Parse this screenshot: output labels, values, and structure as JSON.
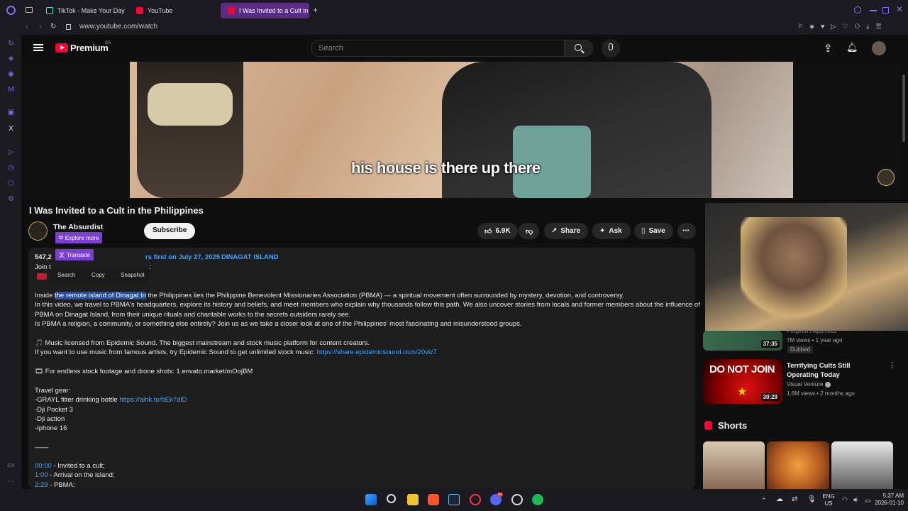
{
  "browser": {
    "tabs": [
      {
        "label": "TikTok - Make Your Day"
      },
      {
        "label": "YouTube"
      },
      {
        "label": "I Was Invited to a Cult in the Philippines"
      }
    ],
    "url": "www.youtube.com/watch"
  },
  "youtube": {
    "logo": "Premium",
    "region": "CA",
    "search_placeholder": "Search"
  },
  "video": {
    "caption": "his house is there up there",
    "title": "I Was Invited to a Cult in the Philippines",
    "channel": "The Absurdist",
    "subscribe_label": "Subscribe",
    "likes": "6.9K",
    "share_label": "Share",
    "ask_label": "Ask",
    "save_label": "Save"
  },
  "popup": {
    "explore": "Explore more",
    "translate": "Translate",
    "search": "Search",
    "copy": "Copy",
    "snapshot": "Snapshot"
  },
  "description": {
    "views_prefix": "547,2",
    "premiere_suffix": "rs first on July 27, 2025",
    "tag": "DINAGAT ISLAND",
    "join_prefix": "Join t",
    "join_suffix": ":",
    "p1_a": "Inside ",
    "p1_sel": "the remote island of Dinagat in",
    "p1_b": " the Philippines lies the Philippine Benevolent Missionaries Association (PBMA) — a spiritual movement often surrounded by mystery, devotion, and controversy.",
    "p2": "In this video, we travel to PBMA's headquarters, explore its history and beliefs, and meet members who explain why thousands follow this path. We also uncover stories from locals and former members about the influence of",
    "p3": "PBMA on Dinagat Island, from their unique rituals and charitable works to the secrets outsiders rarely see.",
    "p4": "Is PBMA a religion, a community, or something else entirely? Join us as we take a closer look at one of the Philippines' most fascinating and misunderstood groups.",
    "music1": "🎵 Music licensed from Epidemic Sound. The biggest mainstream and stock music platform for content creators.",
    "music2": "If you want to use music from famous artists, try Epidemic Sound to get unlimited stock music: ",
    "music_link": "https://share.epidemicsound.com/20vlz7",
    "stock": "🎞 For endless stock footage and drone shots: 1.envato.market/mOojBM",
    "gear_title": "Travel gear:",
    "gear1": "-GRAYL filter drinking bottle ",
    "gear1_link": "https://alnk.to/bEk7dlD",
    "gear2": "-Dji Pocket 3",
    "gear3": "-Dji action",
    "gear4": "-Iphone 16",
    "divider": "——",
    "chapters": [
      {
        "time": "00:00",
        "label": " - Invited to a cult;"
      },
      {
        "time": "1:00",
        "label": " - Arrival on the island;"
      },
      {
        "time": "2:29",
        "label": " - PBMA;"
      }
    ]
  },
  "recommendations": [
    {
      "channel": "Progetto Happiness",
      "meta": "7M views • 1 year ago",
      "badge": "Dubbed",
      "duration": "37:35"
    },
    {
      "title": "Terrifying Cults Still Operating Today",
      "thumb_text": "DO NOT JOIN",
      "channel": "Visual Venture",
      "meta": "1.6M views • 2 months ago",
      "duration": "30:29"
    }
  ],
  "shorts_label": "Shorts",
  "tray": {
    "lang1": "ENG",
    "lang2": "US",
    "time": "5:37 AM",
    "date": "2026-01-10",
    "discord_badge": "9+"
  },
  "colors": {
    "accent": "#7b3fd1",
    "youtube_red": "#ff0033",
    "link": "#3ea6ff"
  }
}
